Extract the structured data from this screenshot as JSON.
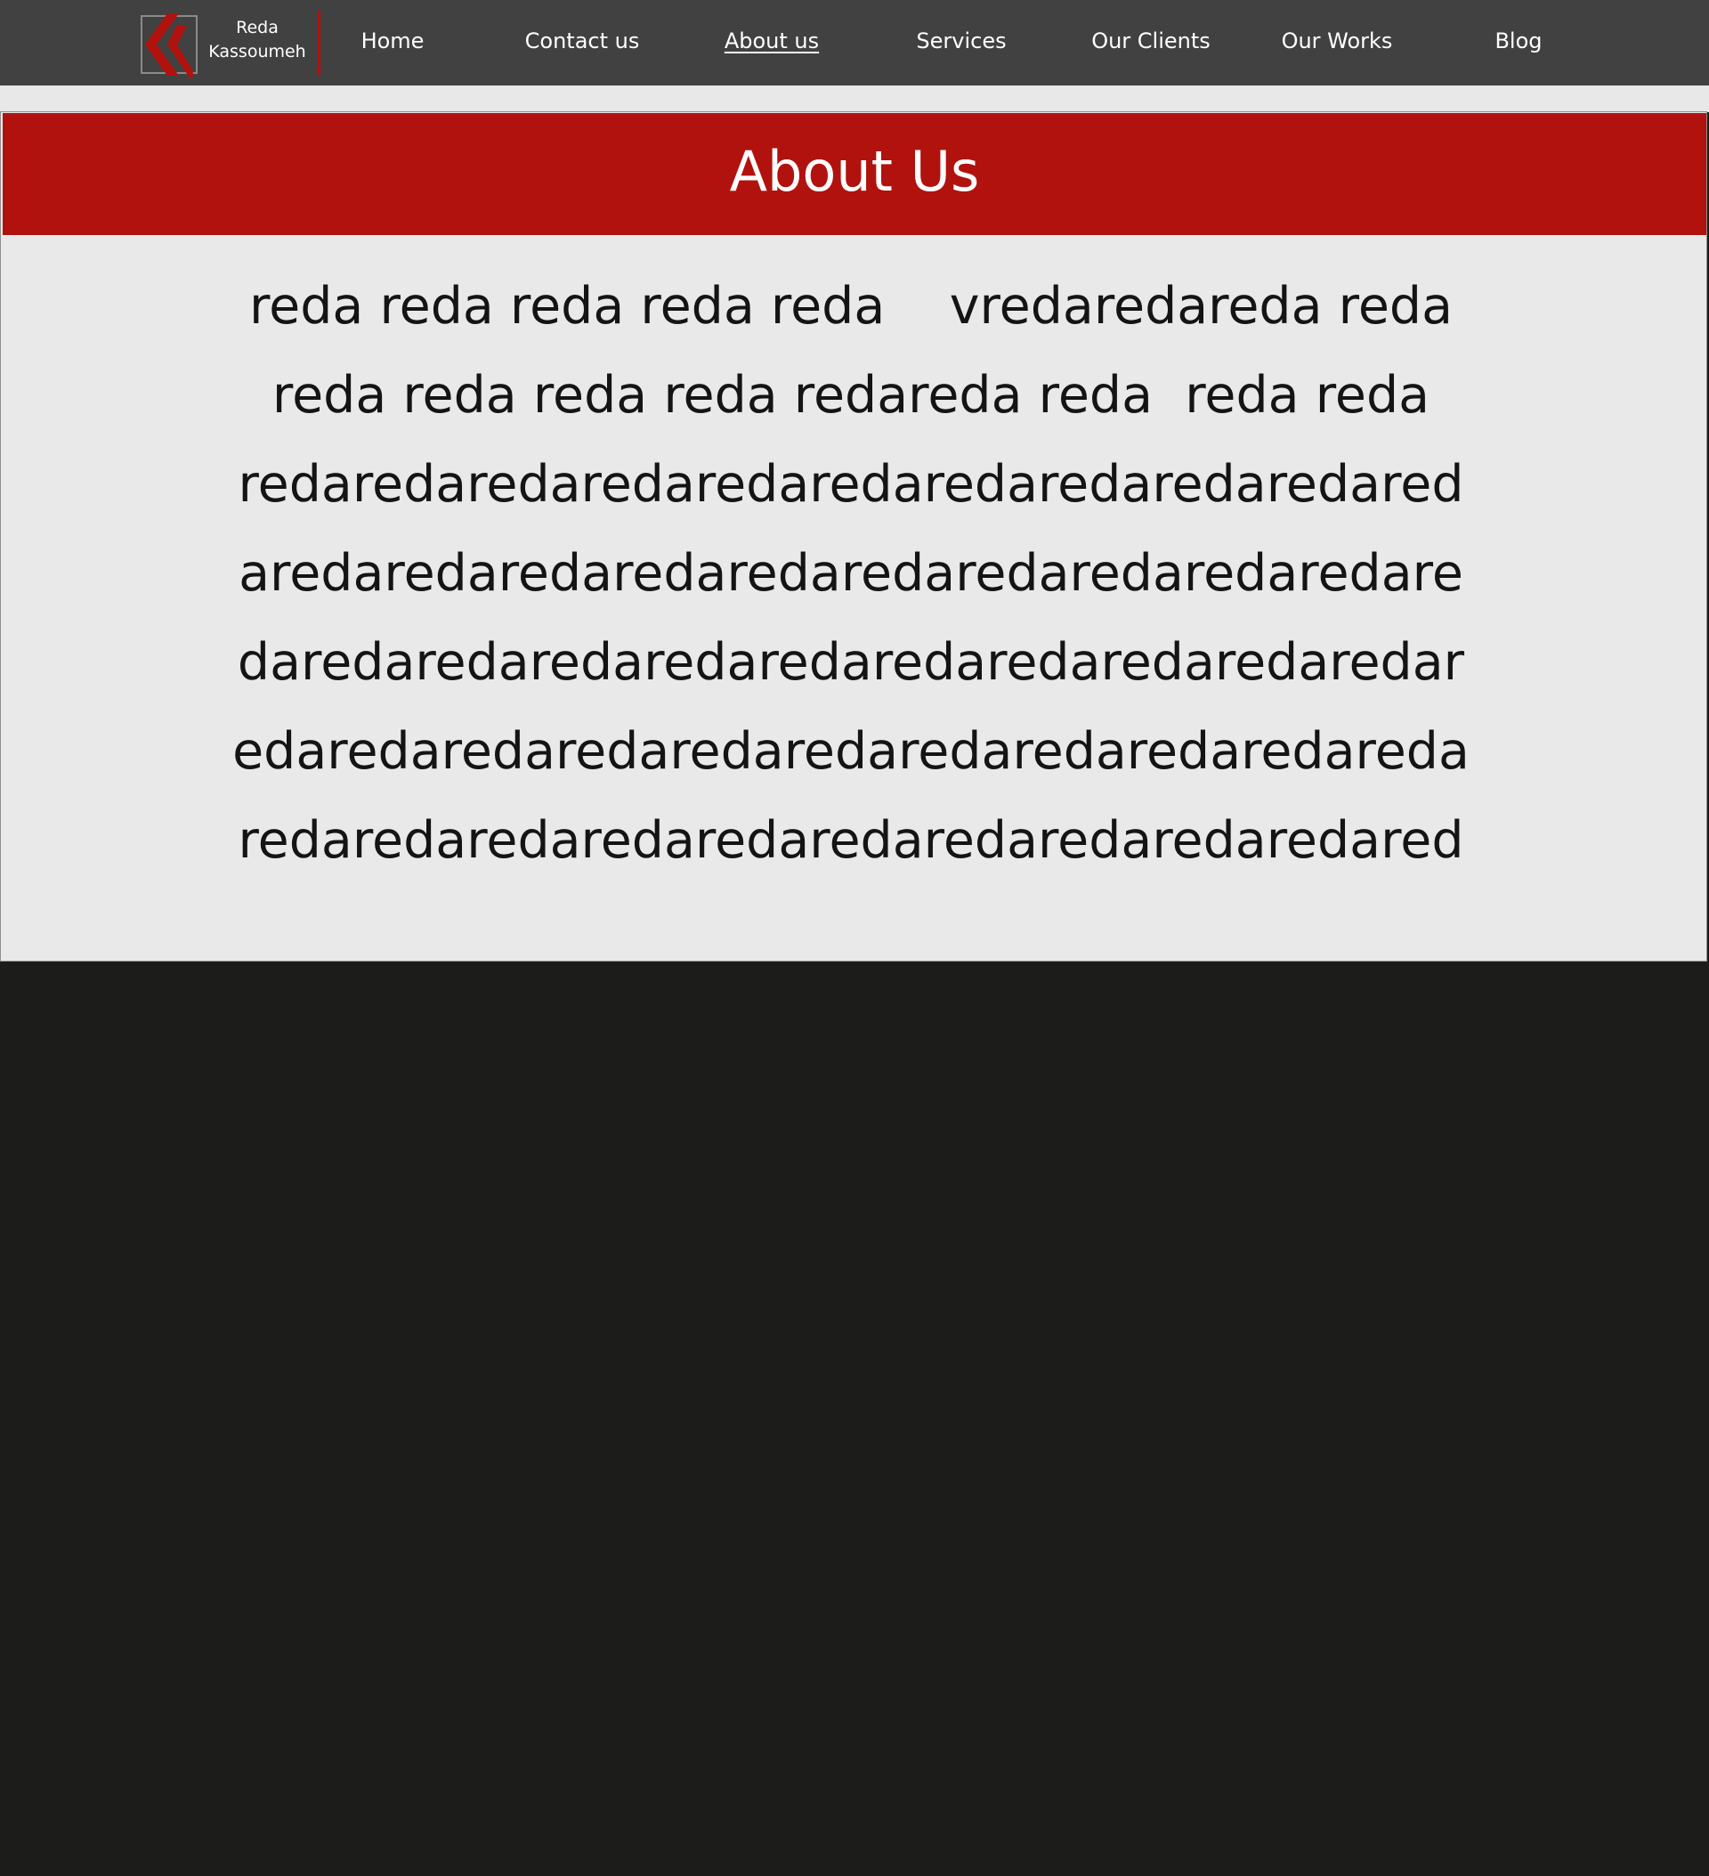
{
  "header": {
    "logo": {
      "icon": "rk-chevron-logo",
      "name_line1": "Reda",
      "name_line2": "Kassoumeh"
    },
    "nav": [
      {
        "label": "Home",
        "active": false
      },
      {
        "label": "Contact us",
        "active": false
      },
      {
        "label": "About us",
        "active": true
      },
      {
        "label": "Services",
        "active": false
      },
      {
        "label": "Our Clients",
        "active": false
      },
      {
        "label": "Our Works",
        "active": false
      },
      {
        "label": "Blog",
        "active": false
      }
    ]
  },
  "banner": {
    "title": "About Us"
  },
  "body": {
    "lines": [
      "reda reda reda reda reda    vredaredareda reda",
      "reda reda reda reda redareda reda  reda reda",
      "redaredaredaredaredaredaredaredaredaredared",
      "aredaredaredaredaredaredaredaredaredaredare",
      "daredaredaredaredaredaredaredaredaredaredar",
      "edaredaredaredaredaredaredaredaredaredareda",
      "redaredaredaredaredaredaredaredaredaredared"
    ]
  },
  "colors": {
    "header_bg": "#414141",
    "accent": "#b1120e",
    "content_bg": "#e9e9e9",
    "page_bg": "#1c1c1b",
    "text": "#141414"
  }
}
